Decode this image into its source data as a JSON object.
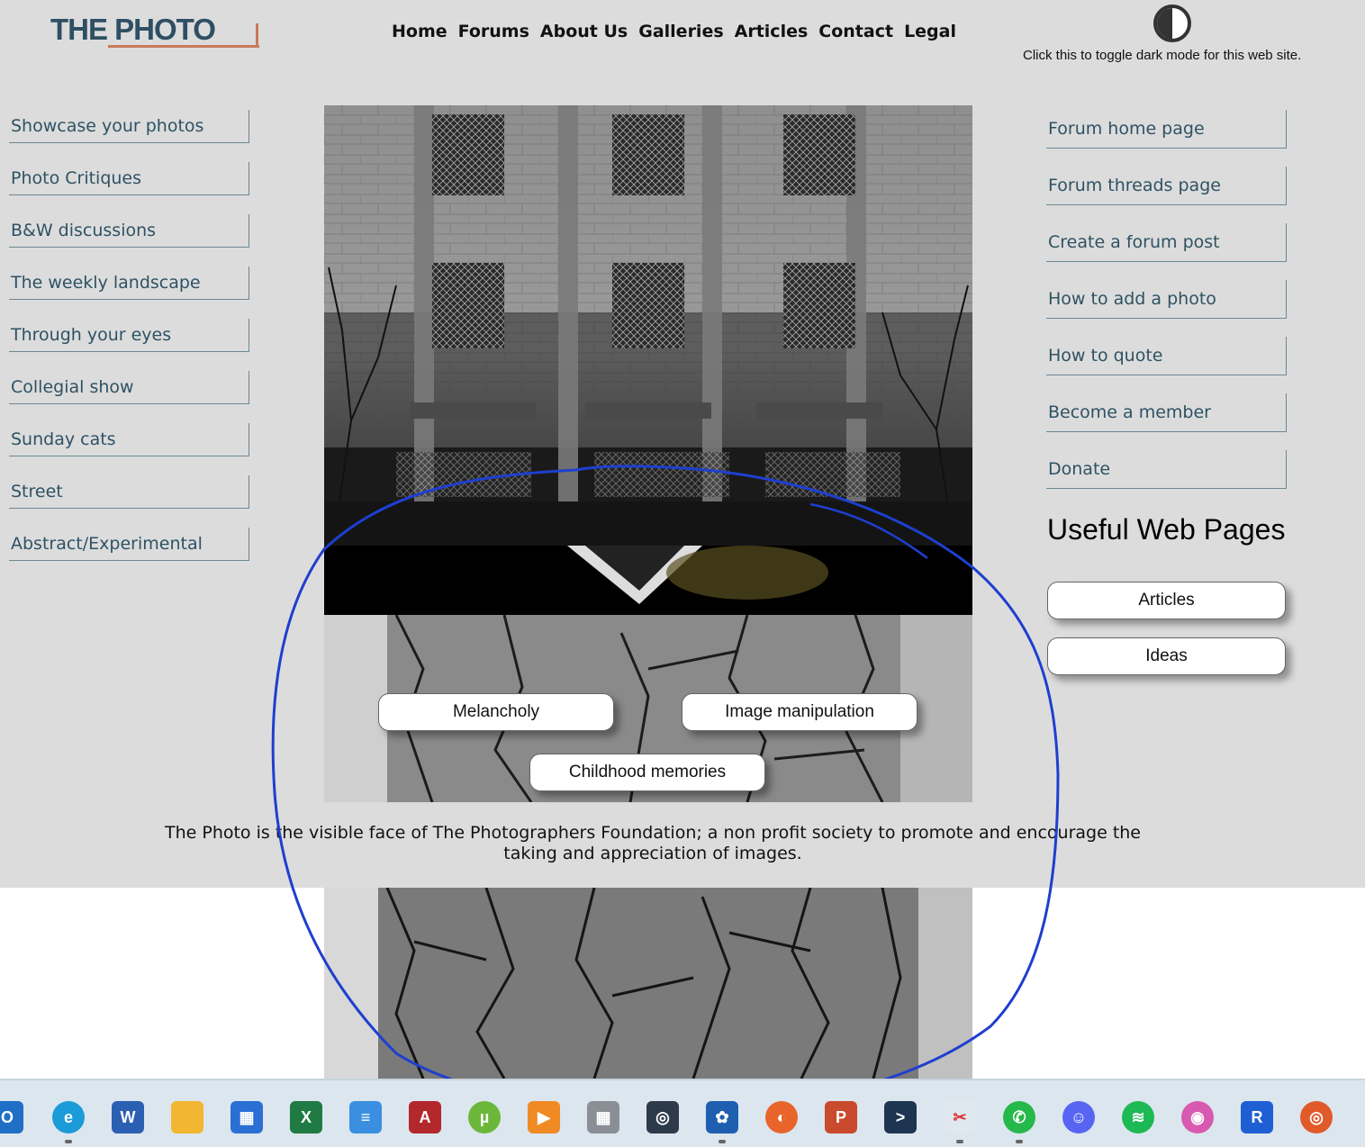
{
  "header": {
    "logo_text": "THE PHOTO",
    "nav": [
      "Home",
      "Forums",
      "About Us",
      "Galleries",
      "Articles",
      "Contact",
      "Legal"
    ],
    "dark_mode_hint": "Click this to toggle dark mode for this web site."
  },
  "left_nav": {
    "items": [
      "Showcase your photos",
      "Photo Critiques",
      "B&W discussions",
      "The weekly landscape",
      "Through your eyes",
      "Collegial show",
      "Sunday cats",
      "Street",
      "Abstract/Experimental"
    ]
  },
  "right_nav": {
    "items": [
      "Forum home page",
      "Forum threads page",
      "Create a forum post",
      "How to add a photo",
      "How to quote",
      "Become a member",
      "Donate"
    ]
  },
  "useful": {
    "title": "Useful Web Pages",
    "buttons": [
      "Articles",
      "Ideas"
    ]
  },
  "overlay_buttons": {
    "melancholy": "Melancholy",
    "image_manipulation": "Image manipulation",
    "childhood_memories": "Childhood memories"
  },
  "tagline": "The Photo is the visible face of The Photographers Foundation; a non profit society to promote and encourage the taking and appreciation of images.",
  "taskbar": {
    "icons": [
      "outlook-icon",
      "edge-icon",
      "word-icon",
      "file-explorer-icon",
      "microsoft-store-icon",
      "excel-icon",
      "notepad-icon",
      "access-icon",
      "utorrent-icon",
      "media-player-icon",
      "calculator-icon",
      "camera-app-icon",
      "photo-app-icon",
      "firefox-icon",
      "powerpoint-icon",
      "terminal-icon",
      "snipping-tool-icon",
      "whatsapp-icon",
      "discord-icon",
      "spotify-icon",
      "photo-editor-icon",
      "r-app-icon",
      "screenshot-tool-icon"
    ]
  },
  "colors": {
    "page_bg": "#dcdcdc",
    "link": "#2e5264",
    "logo": "#2e4f63",
    "logo_accent": "#c97a5a",
    "annotation": "#1e3fcf"
  }
}
